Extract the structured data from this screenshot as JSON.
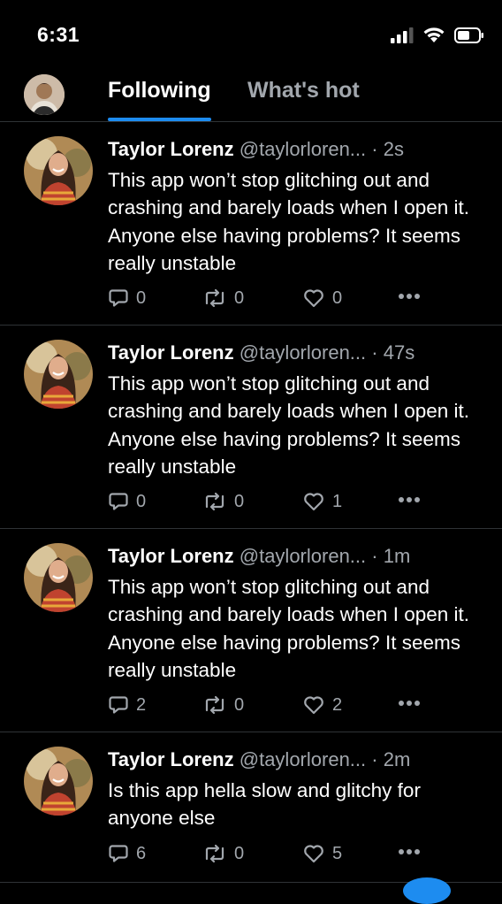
{
  "status_bar": {
    "time": "6:31",
    "icons": [
      "signal-icon",
      "wifi-icon",
      "battery-icon"
    ]
  },
  "header": {
    "tabs": [
      {
        "label": "Following",
        "active": true
      },
      {
        "label": "What's hot",
        "active": false
      }
    ]
  },
  "colors": {
    "background": "#000000",
    "accent": "#1d8cf0",
    "muted": "#a2a7ad",
    "divider": "#2f3336"
  },
  "posts": [
    {
      "author": "Taylor Lorenz",
      "handle": "@taylorloren...",
      "separator": "·",
      "time": "2s",
      "text": "This app won’t stop glitching out and crashing and barely loads when I open it. Anyone else having problems? It seems really unstable",
      "replies": "0",
      "reposts": "0",
      "likes": "0"
    },
    {
      "author": "Taylor Lorenz",
      "handle": "@taylorloren...",
      "separator": "·",
      "time": "47s",
      "text": "This app won’t stop glitching out and crashing and barely loads when I open it. Anyone else having problems? It seems really unstable",
      "replies": "0",
      "reposts": "0",
      "likes": "1"
    },
    {
      "author": "Taylor Lorenz",
      "handle": "@taylorloren...",
      "separator": "·",
      "time": "1m",
      "text": "This app won’t stop glitching out and crashing and barely loads when I open it. Anyone else having problems? It seems really unstable",
      "replies": "2",
      "reposts": "0",
      "likes": "2"
    },
    {
      "author": "Taylor Lorenz",
      "handle": "@taylorloren...",
      "separator": "·",
      "time": "2m",
      "text": "Is this app hella slow and glitchy for anyone else",
      "replies": "6",
      "reposts": "0",
      "likes": "5"
    }
  ]
}
